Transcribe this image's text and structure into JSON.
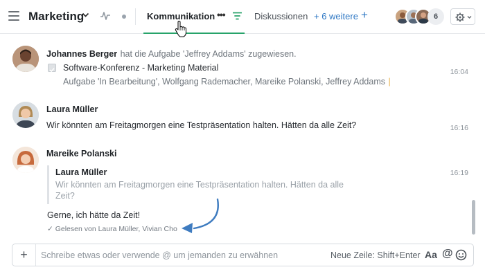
{
  "header": {
    "title": "Marketing",
    "active_tab": "Kommunikation",
    "tab_more": "•••",
    "tab_2": "Diskussionen",
    "more_tabs_link": "+ 6 weitere",
    "add_tab": "+",
    "member_count": "6"
  },
  "messages": [
    {
      "author": "Johannes Berger",
      "system_text": "hat die Aufgabe 'Jeffrey Addams' zugewiesen.",
      "task_title": "Software-Konferenz - Marketing Material",
      "task_detail": "Aufgabe 'In Bearbeitung', Wolfgang Rademacher, Mareike Polanski, Jeffrey Addams",
      "task_separator": "|",
      "time": "16:04"
    },
    {
      "author": "Laura Müller",
      "text": "Wir könnten am Freitagmorgen eine Testpräsentation halten. Hätten da alle Zeit?",
      "time": "16:16"
    },
    {
      "author": "Mareike Polanski",
      "quote_author": "Laura Müller",
      "quote_text": "Wir könnten am Freitagmorgen eine Testpräsentation halten. Hätten da alle Zeit?",
      "text": "Gerne, ich hätte da Zeit!",
      "read_receipt": "✓ Gelesen von Laura Müller, Vivian Cho",
      "time": "16:19"
    }
  ],
  "composer": {
    "add_label": "+",
    "placeholder": "Schreibe etwas oder verwende @ um jemanden zu erwähnen",
    "newline_hint": "Neue Zeile: Shift+Enter",
    "format_label": "Aa",
    "mention_label": "@"
  },
  "colors": {
    "accent_green": "#27a36a",
    "link_blue": "#2f78c4",
    "annotation_arrow": "#3f7cc0"
  },
  "icons": [
    "menu-icon",
    "chevron-down-icon",
    "activity-icon",
    "status-dot-icon",
    "filter-icon",
    "gear-icon",
    "checkbox-icon",
    "emoji-icon",
    "hand-cursor-icon",
    "curved-arrow-icon"
  ]
}
